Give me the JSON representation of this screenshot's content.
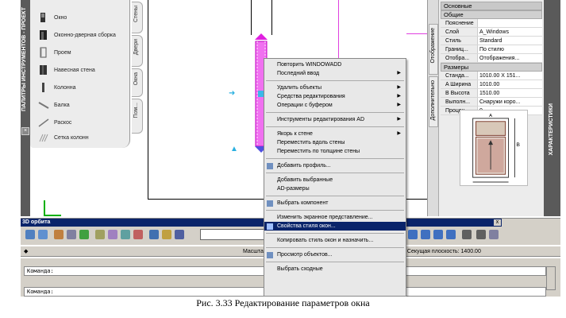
{
  "palette": {
    "title": "ПАЛИТРЫ ИНСТРУМЕНТОВ - ПРОЕКТ",
    "items": [
      {
        "label": "Окно",
        "icon": "window-icon"
      },
      {
        "label": "Оконно-дверная сборка",
        "icon": "window-door-assembly-icon"
      },
      {
        "label": "Проем",
        "icon": "opening-icon"
      },
      {
        "label": "Навесная стена",
        "icon": "curtain-wall-icon"
      },
      {
        "label": "Колонна",
        "icon": "column-icon"
      },
      {
        "label": "Балка",
        "icon": "beam-icon"
      },
      {
        "label": "Раскос",
        "icon": "brace-icon"
      },
      {
        "label": "Сетка колонн",
        "icon": "column-grid-icon"
      }
    ],
    "tabs": [
      "Стены",
      "Двери",
      "Окна",
      "Пом..."
    ]
  },
  "context_menu": {
    "items": [
      {
        "label": "Повторить WINDOWADD",
        "submenu": false,
        "selected": false
      },
      {
        "label": "Последний ввод",
        "submenu": true,
        "selected": false
      },
      {
        "sep": true
      },
      {
        "label": "Удалить объекты",
        "submenu": true,
        "selected": false
      },
      {
        "label": "Средства редактирования",
        "submenu": true,
        "selected": false
      },
      {
        "label": "Операции с буфером",
        "submenu": true,
        "selected": false
      },
      {
        "sep": true
      },
      {
        "label": "Инструменты редактирования AD",
        "submenu": true,
        "selected": false
      },
      {
        "sep": true
      },
      {
        "label": "Якорь к стене",
        "submenu": true,
        "selected": false
      },
      {
        "label": "Переместить вдоль стены",
        "submenu": false,
        "selected": false
      },
      {
        "label": "Переместить по толщине стены",
        "submenu": false,
        "selected": false
      },
      {
        "sep": true
      },
      {
        "label": "Добавить профиль...",
        "submenu": false,
        "selected": false,
        "icon": true
      },
      {
        "sep": true
      },
      {
        "label": "Добавить выбранные",
        "submenu": false,
        "selected": false
      },
      {
        "label": "AD-размеры",
        "submenu": false,
        "selected": false
      },
      {
        "sep": true
      },
      {
        "label": "Выбрать компонент",
        "submenu": false,
        "selected": false,
        "icon": true
      },
      {
        "sep": true
      },
      {
        "label": "Изменить экранное представление...",
        "submenu": false,
        "selected": false
      },
      {
        "label": "Свойства стиля окон...",
        "submenu": false,
        "selected": true,
        "icon": true
      },
      {
        "sep": true
      },
      {
        "label": "Копировать стиль окон и назначить...",
        "submenu": false,
        "selected": false
      },
      {
        "sep": true
      },
      {
        "label": "Просмотр объектов...",
        "submenu": false,
        "selected": false,
        "icon": true
      },
      {
        "sep": true
      },
      {
        "label": "Выбрать сходные",
        "submenu": false,
        "selected": false
      }
    ]
  },
  "properties": {
    "header": "Основные",
    "sections": [
      {
        "title": "Общие",
        "rows": [
          {
            "k": "Пояснение",
            "v": ""
          },
          {
            "k": "Слой",
            "v": "A_Windows"
          },
          {
            "k": "Стиль",
            "v": "Standard"
          },
          {
            "k": "Границ...",
            "v": "По стилю"
          },
          {
            "k": "Отобра...",
            "v": "Отображения..."
          }
        ]
      },
      {
        "title": "Размеры",
        "rows": [
          {
            "k": "Станда...",
            "v": "1010.00 X 151..."
          },
          {
            "k": "Ширина",
            "v": "1010.00",
            "mark": "A"
          },
          {
            "k": "Высота",
            "v": "1510.00",
            "mark": "B"
          },
          {
            "k": "Выполн...",
            "v": "Снаружи коро..."
          },
          {
            "k": "Процен...",
            "v": "0"
          }
        ]
      }
    ],
    "tabs": [
      "Отображение",
      "Дополнительно"
    ],
    "right_title": "ХАРАКТЕРИСТИКИ",
    "preview_labels": {
      "a": "A",
      "b": "B"
    }
  },
  "orbit": {
    "title": "3D орбита",
    "close": "x"
  },
  "status": {
    "left": "Масшта",
    "right": "во ▾  Секущая плоскость:  1400.00"
  },
  "command": {
    "line1": "Команда:",
    "line2": "Команда:"
  },
  "caption": "Рис. 3.33 Редактирование параметров окна"
}
